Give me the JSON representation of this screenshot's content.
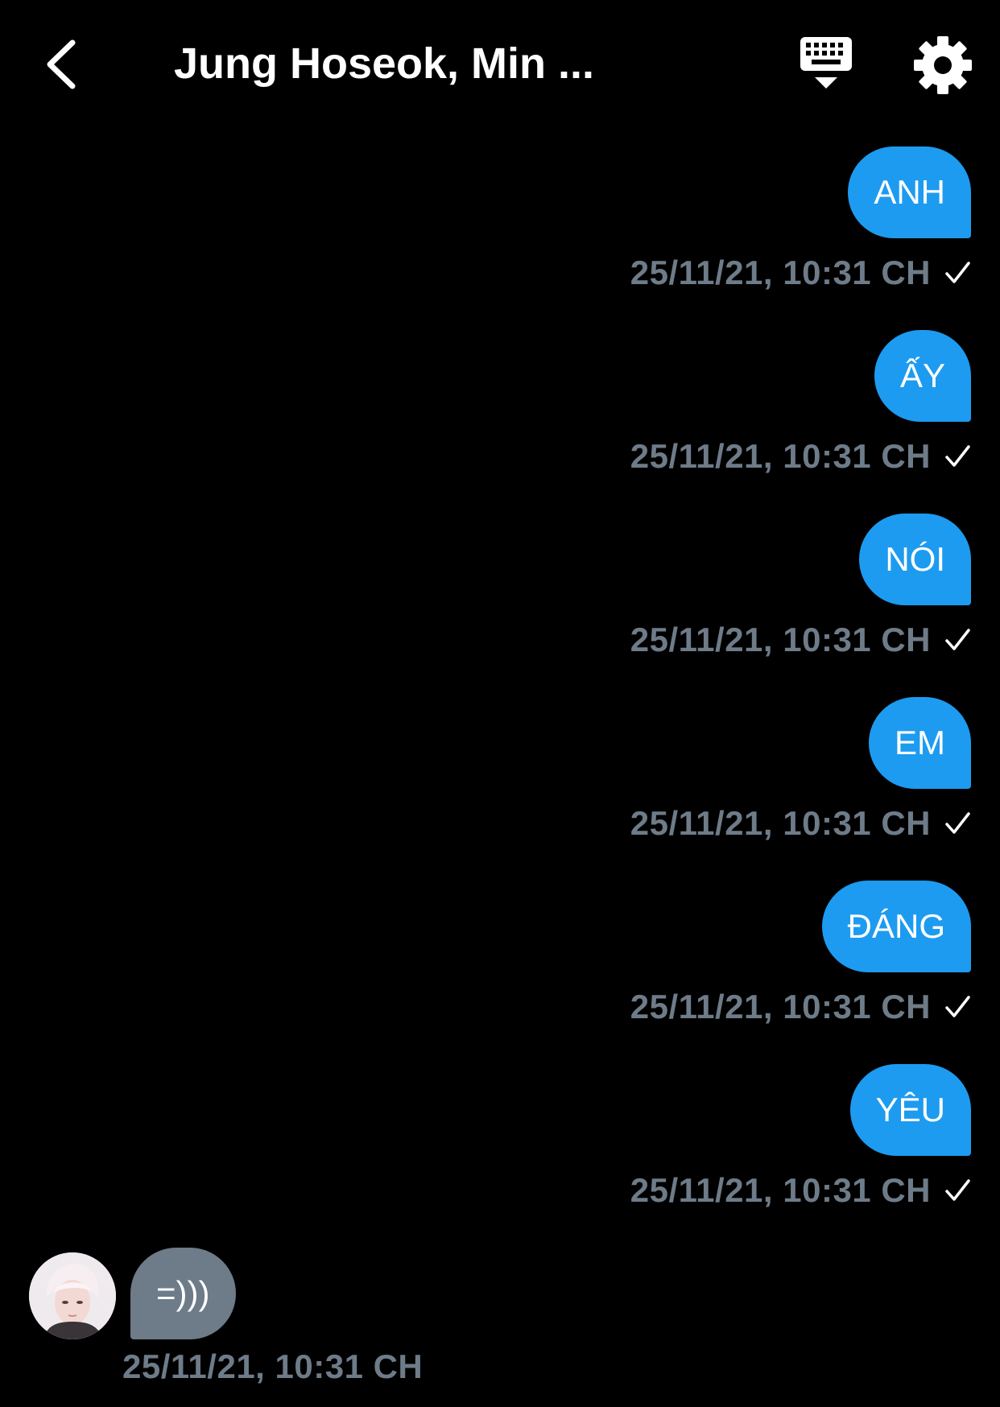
{
  "header": {
    "title": "Jung Hoseok, Min ...",
    "back_icon": "chevron-left-icon",
    "keyboard_icon": "keyboard-hide-icon",
    "settings_icon": "gear-icon"
  },
  "colors": {
    "background": "#000000",
    "sent_bubble": "#1d9bf0",
    "received_bubble": "#6e7b88",
    "timestamp": "#6e7b88",
    "text": "#ffffff"
  },
  "messages": [
    {
      "text": "ANH",
      "time": "25/11/21, 10:31 CH",
      "status": "check-icon"
    },
    {
      "text": "ẤY",
      "time": "25/11/21, 10:31 CH",
      "status": "check-icon"
    },
    {
      "text": "NÓI",
      "time": "25/11/21, 10:31 CH",
      "status": "check-icon"
    },
    {
      "text": "EM",
      "time": "25/11/21, 10:31 CH",
      "status": "check-icon"
    },
    {
      "text": "ĐÁNG",
      "time": "25/11/21, 10:31 CH",
      "status": "check-icon"
    },
    {
      "text": "YÊU",
      "time": "25/11/21, 10:31 CH",
      "status": "check-icon"
    }
  ],
  "received": {
    "text": "=)))",
    "time": "25/11/21, 10:31 CH",
    "avatar": "avatar"
  }
}
